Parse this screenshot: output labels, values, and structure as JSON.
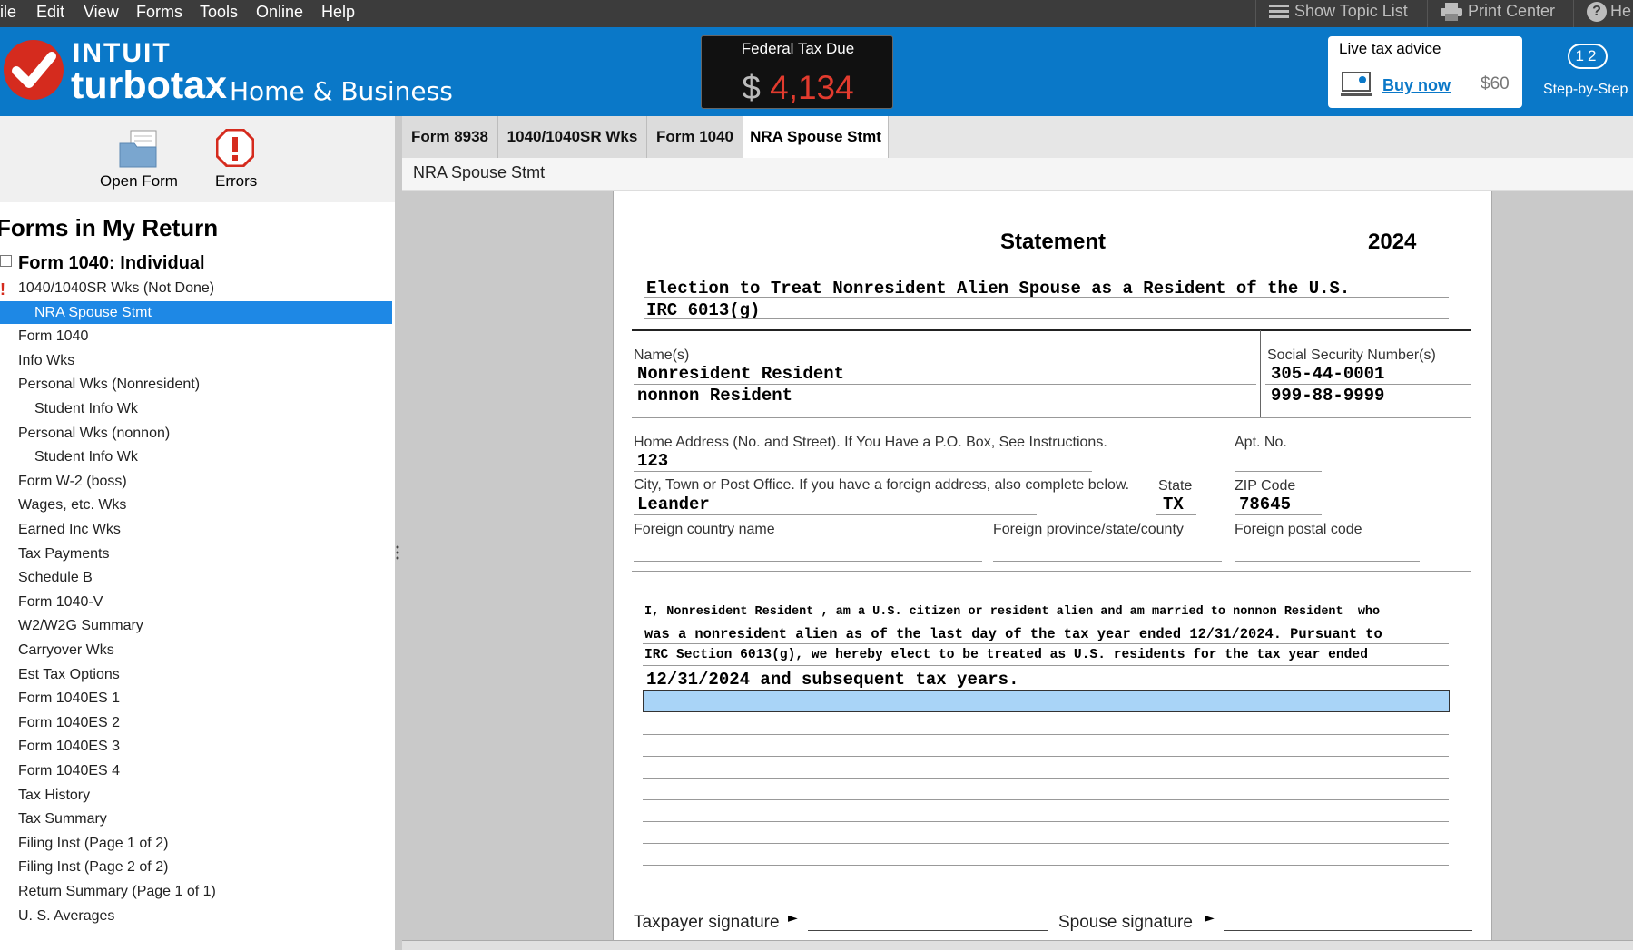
{
  "menu": {
    "items": [
      "ile",
      "Edit",
      "View",
      "Forms",
      "Tools",
      "Online",
      "Help"
    ],
    "right": [
      "Show Topic List",
      "Print Center",
      "He"
    ]
  },
  "header": {
    "brand": "INTUIT",
    "product": "turbotax",
    "edition": "Home & Business",
    "tax_due_label": "Federal Tax Due",
    "tax_due_currency": "$",
    "tax_due_amount": "4,134",
    "live_advice_title": "Live tax advice",
    "buy_now": "Buy now",
    "price": "$60",
    "step_by_step": "Step-by-Step",
    "step_icon_text": "12"
  },
  "sidebar": {
    "open_form": "Open Form",
    "errors": "Errors",
    "forms_title": "Forms in My Return",
    "group_label": "Form 1040:  Individual",
    "items": [
      {
        "label": "1040/1040SR Wks (Not Done)",
        "indent": 1,
        "error": true
      },
      {
        "label": "NRA Spouse Stmt",
        "indent": 2,
        "selected": true
      },
      {
        "label": "Form 1040",
        "indent": 1
      },
      {
        "label": "Info Wks",
        "indent": 1
      },
      {
        "label": "Personal Wks (Nonresident)",
        "indent": 1
      },
      {
        "label": "Student Info Wk",
        "indent": 2
      },
      {
        "label": "Personal Wks (nonnon)",
        "indent": 1
      },
      {
        "label": "Student Info Wk",
        "indent": 2
      },
      {
        "label": "Form W-2 (boss)",
        "indent": 1
      },
      {
        "label": "Wages, etc. Wks",
        "indent": 1
      },
      {
        "label": "Earned Inc Wks",
        "indent": 1
      },
      {
        "label": "Tax Payments",
        "indent": 1
      },
      {
        "label": "Schedule B",
        "indent": 1
      },
      {
        "label": "Form 1040-V",
        "indent": 1
      },
      {
        "label": "W2/W2G Summary",
        "indent": 1
      },
      {
        "label": "Carryover Wks",
        "indent": 1
      },
      {
        "label": "Est Tax Options",
        "indent": 1
      },
      {
        "label": "Form 1040ES 1",
        "indent": 1
      },
      {
        "label": "Form 1040ES 2",
        "indent": 1
      },
      {
        "label": "Form 1040ES 3",
        "indent": 1
      },
      {
        "label": "Form 1040ES 4",
        "indent": 1
      },
      {
        "label": "Tax History",
        "indent": 1
      },
      {
        "label": "Tax Summary",
        "indent": 1
      },
      {
        "label": "Filing Inst (Page 1 of 2)",
        "indent": 1
      },
      {
        "label": "Filing Inst (Page 2 of 2)",
        "indent": 1
      },
      {
        "label": "Return Summary (Page 1 of 1)",
        "indent": 1
      },
      {
        "label": "U. S. Averages",
        "indent": 1
      }
    ]
  },
  "tabs": [
    {
      "label": "Form 8938"
    },
    {
      "label": "1040/1040SR Wks"
    },
    {
      "label": "Form 1040"
    },
    {
      "label": "NRA Spouse Stmt",
      "active": true
    }
  ],
  "form_title": "NRA Spouse Stmt",
  "form": {
    "heading": "Statement",
    "year": "2024",
    "subtitle_1": "Election to Treat Nonresident Alien Spouse as a Resident of the U.S.",
    "subtitle_2": "IRC 6013(g)",
    "names_label": "Name(s)",
    "name_1": "Nonresident Resident",
    "name_2": "nonnon Resident",
    "ssn_label": "Social Security Number(s)",
    "ssn_1": "305-44-0001",
    "ssn_2": "999-88-9999",
    "address_label": "Home Address (No. and Street). If You Have a P.O. Box, See Instructions.",
    "address": "123",
    "apt_label": "Apt.  No.",
    "city_label": "City, Town or Post Office. If you have a foreign address, also complete below.",
    "city": "Leander",
    "state_label": "State",
    "state": "TX",
    "zip_label": "ZIP Code",
    "zip": "78645",
    "foreign_country_label": "Foreign country name",
    "foreign_province_label": "Foreign province/state/county",
    "foreign_postal_label": "Foreign postal code",
    "stmt_line_1": "I, Nonresident Resident , am a U.S. citizen or resident alien and am married to nonnon Resident  who",
    "stmt_line_2": "was a nonresident alien as of the last day of the tax year ended 12/31/2024. Pursuant to",
    "stmt_line_3": "IRC Section 6013(g), we hereby elect to be treated as U.S. residents for the tax year ended",
    "stmt_line_4": "12/31/2024 and subsequent tax years.",
    "taxpayer_sig_label": "Taxpayer signature",
    "spouse_sig_label": "Spouse signature",
    "arrow": "►"
  },
  "colors": {
    "header_blue": "#0a78c8",
    "selected_blue": "#1e88e5",
    "tax_due_red": "#e23b2e",
    "input_highlight": "#a9d4f7"
  }
}
